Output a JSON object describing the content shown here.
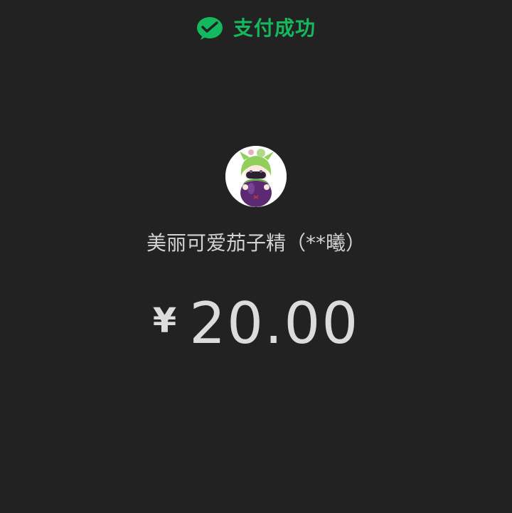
{
  "header": {
    "status_text": "支付成功",
    "icon": "wechat-pay-icon",
    "accent_color": "#14b85e"
  },
  "payee": {
    "avatar_icon": "eggplant-avatar",
    "name": "美丽可爱茄子精（**曦）"
  },
  "payment": {
    "currency_symbol": "¥",
    "amount": "20.00"
  },
  "theme": {
    "background": "#222222",
    "text_color": "#dcdcdc"
  }
}
